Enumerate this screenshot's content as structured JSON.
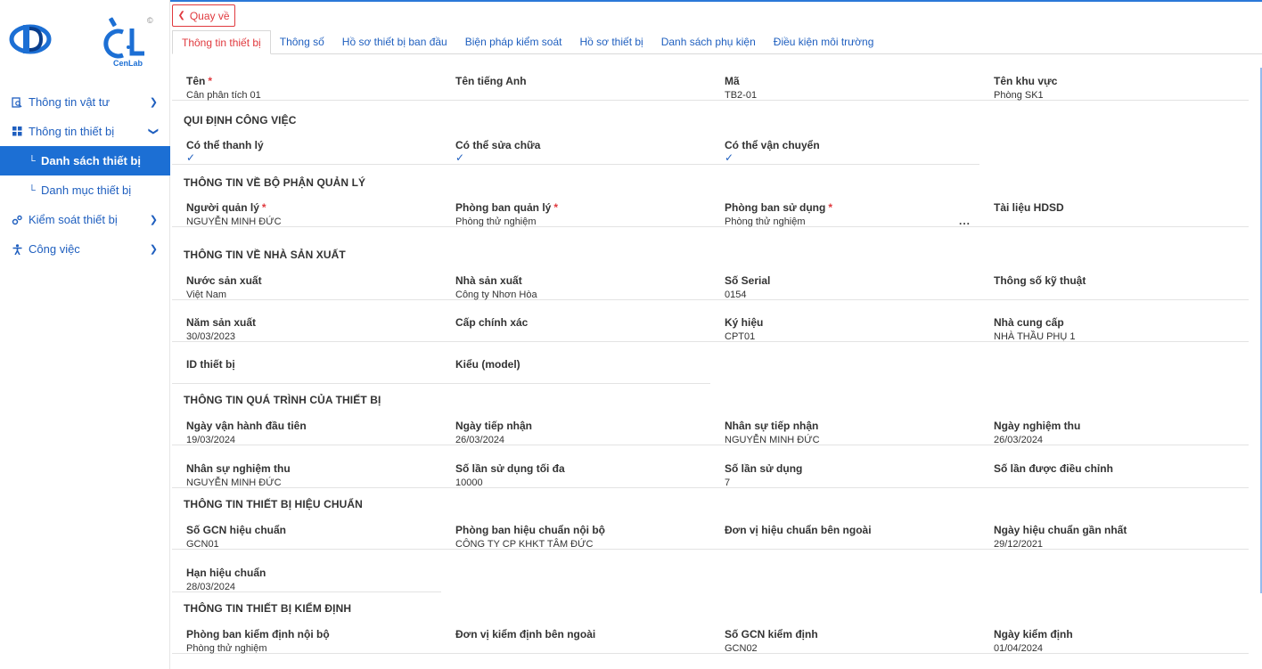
{
  "brand": {
    "logo_text": "CenLab",
    "copyright_mark": "©"
  },
  "sidebar": {
    "items": [
      {
        "label": "Thông tin vật tư",
        "icon": "search-document-icon"
      },
      {
        "label": "Thông tin thiết bị",
        "icon": "grid-icon"
      },
      {
        "label": "Danh sách thiết bị",
        "sub": true,
        "active": true
      },
      {
        "label": "Danh mục thiết bị",
        "sub": true
      },
      {
        "label": "Kiểm soát thiết bị",
        "icon": "gears-icon"
      },
      {
        "label": "Công việc",
        "icon": "person-icon"
      }
    ]
  },
  "header": {
    "back_label": "Quay về"
  },
  "tabs": [
    {
      "label": "Thông tin thiết bị",
      "active": true
    },
    {
      "label": "Thông số"
    },
    {
      "label": "Hồ sơ thiết bị ban đầu"
    },
    {
      "label": "Biện pháp kiểm soát"
    },
    {
      "label": "Hồ sơ thiết bị"
    },
    {
      "label": "Danh sách phụ kiện"
    },
    {
      "label": "Điều kiện môi trường"
    }
  ],
  "general": {
    "ten_label": "Tên",
    "ten_value": "Cân phân tích 01",
    "ten_tieng_anh_label": "Tên tiếng Anh",
    "ten_tieng_anh_value": "",
    "ma_label": "Mã",
    "ma_value": "TB2-01",
    "ten_khu_vuc_label": "Tên khu vực",
    "ten_khu_vuc_value": "Phòng SK1"
  },
  "qui_dinh": {
    "title": "QUI ĐỊNH CÔNG VIỆC",
    "thanh_ly_label": "Có thể thanh lý",
    "sua_chua_label": "Có thể sửa chữa",
    "van_chuyen_label": "Có thể vận chuyển",
    "check": "✓"
  },
  "quan_ly": {
    "title": "THÔNG TIN VỀ BỘ PHẬN QUẢN LÝ",
    "nguoi_quan_ly_label": "Người quản lý",
    "nguoi_quan_ly_value": "NGUYỄN MINH ĐỨC",
    "phong_ban_quan_ly_label": "Phòng ban quản lý",
    "phong_ban_quan_ly_value": "Phòng thử nghiệm",
    "phong_ban_su_dung_label": "Phòng ban sử dụng",
    "phong_ban_su_dung_value": "Phòng thử nghiệm",
    "tai_lieu_label": "Tài liệu HDSD",
    "more": "..."
  },
  "nha_san_xuat": {
    "title": "THÔNG TIN VỀ NHÀ SẢN XUẤT",
    "nuoc_label": "Nước sản xuất",
    "nuoc_value": "Việt Nam",
    "nha_sx_label": "Nhà sản xuất",
    "nha_sx_value": "Công ty Nhơn Hòa",
    "serial_label": "Số Serial",
    "serial_value": "0154",
    "thong_so_label": "Thông số kỹ thuật",
    "thong_so_value": "",
    "nam_label": "Năm sản xuất",
    "nam_value": "30/03/2023",
    "cap_label": "Cấp chính xác",
    "cap_value": "",
    "ky_hieu_label": "Ký hiệu",
    "ky_hieu_value": "CPT01",
    "nha_cc_label": "Nhà cung cấp",
    "nha_cc_value": "NHÀ THẦU PHỤ 1",
    "id_label": "ID thiết bị",
    "id_value": "",
    "kieu_label": "Kiểu (model)",
    "kieu_value": ""
  },
  "qua_trinh": {
    "title": "THÔNG TIN QUÁ TRÌNH CỦA THIẾT BỊ",
    "ngay_van_hanh_label": "Ngày vận hành đầu tiên",
    "ngay_van_hanh_value": "19/03/2024",
    "ngay_tiep_nhan_label": "Ngày tiếp nhận",
    "ngay_tiep_nhan_value": "26/03/2024",
    "ns_tiep_nhan_label": "Nhân sự tiếp nhận",
    "ns_tiep_nhan_value": "NGUYỄN MINH ĐỨC",
    "ngay_nghiem_thu_label": "Ngày nghiệm thu",
    "ngay_nghiem_thu_value": "26/03/2024",
    "ns_nghiem_thu_label": "Nhân sự nghiệm thu",
    "ns_nghiem_thu_value": "NGUYỄN MINH ĐỨC",
    "so_lan_toi_da_label": "Số lần sử dụng tối đa",
    "so_lan_toi_da_value": "10000",
    "so_lan_su_dung_label": "Số lần sử dụng",
    "so_lan_su_dung_value": "7",
    "so_lan_dieu_chinh_label": "Số lần được điều chỉnh",
    "so_lan_dieu_chinh_value": ""
  },
  "hieu_chuan": {
    "title": "THÔNG TIN THIẾT BỊ HIỆU CHUẨN",
    "so_gcn_label": "Số GCN hiệu chuẩn",
    "so_gcn_value": "GCN01",
    "pb_noi_bo_label": "Phòng ban hiệu chuẩn nội bộ",
    "pb_noi_bo_value": "CÔNG TY CP KHKT TÂM ĐỨC",
    "dv_ben_ngoai_label": "Đơn vị hiệu chuẩn bên ngoài",
    "dv_ben_ngoai_value": "",
    "ngay_gan_nhat_label": "Ngày hiệu chuẩn gần nhất",
    "ngay_gan_nhat_value": "29/12/2021",
    "han_label": "Hạn hiệu chuẩn",
    "han_value": "28/03/2024"
  },
  "kiem_dinh": {
    "title": "THÔNG TIN THIẾT BỊ KIỂM ĐỊNH",
    "pb_noi_bo_label": "Phòng ban kiểm định nội bộ",
    "pb_noi_bo_value": "Phòng thử nghiệm",
    "dv_ben_ngoai_label": "Đơn vị kiểm định bên ngoài",
    "dv_ben_ngoai_value": "",
    "so_gcn_label": "Số GCN kiểm định",
    "so_gcn_value": "GCN02",
    "ngay_label": "Ngày kiểm định",
    "ngay_value": "01/04/2024"
  },
  "required_mark": "*",
  "colors": {
    "accent": "#1c6fd4",
    "link": "#1f5fbf",
    "danger": "#e0393e"
  }
}
